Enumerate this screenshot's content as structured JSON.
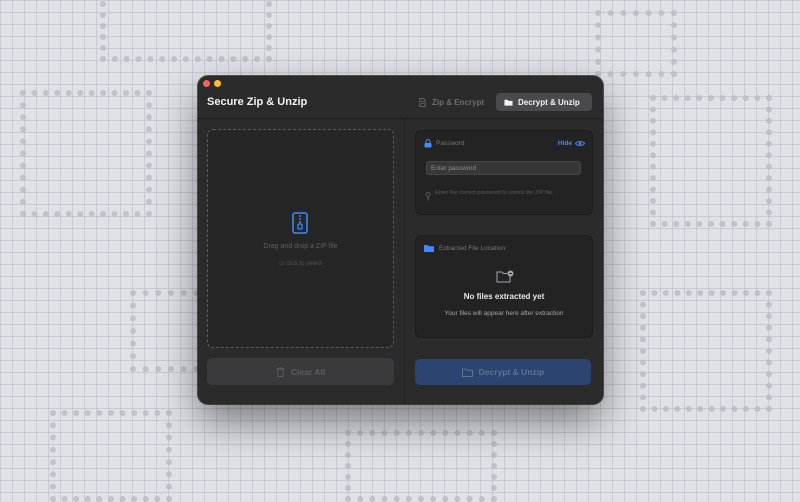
{
  "window": {
    "title": "Secure Zip & Unzip",
    "tabs": [
      {
        "label": "Zip & Encrypt",
        "icon": "document-icon",
        "active": false
      },
      {
        "label": "Decrypt & Unzip",
        "icon": "folder-icon",
        "active": true
      }
    ]
  },
  "left": {
    "drop_text": "Drag and drop a ZIP file",
    "drop_subtext": "or click to select",
    "clear_label": "Clear All"
  },
  "password": {
    "label": "Password",
    "hide_label": "Hide",
    "placeholder": "Enter password",
    "hint": "Enter the correct password to unlock the ZIP file."
  },
  "location": {
    "label": "Extracted File Location",
    "empty_title": "No files extracted yet",
    "empty_subtitle": "Your files will appear here after extraction"
  },
  "actions": {
    "decrypt_label": "Decrypt & Unzip"
  },
  "colors": {
    "accent": "#3d8bff",
    "window_bg": "#2b2b2c",
    "button_primary": "#2b4470"
  }
}
